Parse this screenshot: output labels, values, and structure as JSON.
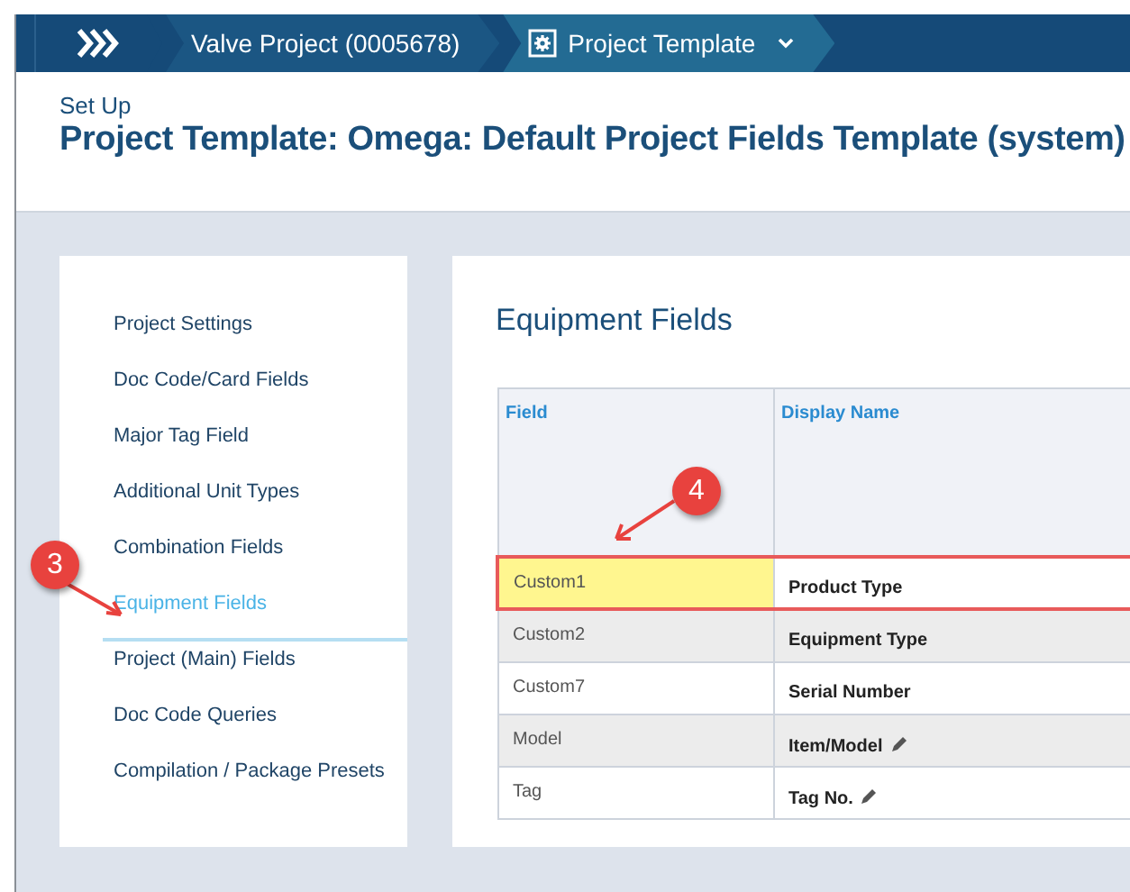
{
  "breadcrumbs": [
    {
      "label": "Valve Project (0005678)",
      "kind": "link",
      "selected": false
    },
    {
      "label": "Project Template",
      "kind": "menu",
      "selected": true
    }
  ],
  "header": {
    "section": "Set Up",
    "title": "Project Template: Omega: Default Project Fields Template (system)"
  },
  "sidebar": {
    "items": [
      {
        "label": "Project Settings",
        "selected": false
      },
      {
        "label": "Doc Code/Card Fields",
        "selected": false
      },
      {
        "label": "Major Tag Field",
        "selected": false
      },
      {
        "label": "Additional Unit Types",
        "selected": false
      },
      {
        "label": "Combination Fields",
        "selected": false
      },
      {
        "label": "Equipment Fields",
        "selected": true
      },
      {
        "label": "Project (Main) Fields",
        "selected": false
      },
      {
        "label": "Doc Code Queries",
        "selected": false
      },
      {
        "label": "Compilation / Package Presets",
        "selected": false
      }
    ]
  },
  "panel": {
    "title": "Equipment Fields",
    "table": {
      "columns": [
        "Field",
        "Display Name"
      ],
      "rows": [
        {
          "field": "Custom1",
          "display_name": "Product Type",
          "highlighted": true,
          "editable": false
        },
        {
          "field": "Custom2",
          "display_name": "Equipment Type",
          "highlighted": false,
          "editable": false
        },
        {
          "field": "Custom7",
          "display_name": "Serial Number",
          "highlighted": false,
          "editable": false
        },
        {
          "field": "Model",
          "display_name": "Item/Model",
          "highlighted": false,
          "editable": true
        },
        {
          "field": "Tag",
          "display_name": "Tag No.",
          "highlighted": false,
          "editable": true
        }
      ]
    }
  },
  "callouts": [
    {
      "label": "3"
    },
    {
      "label": "4"
    }
  ]
}
